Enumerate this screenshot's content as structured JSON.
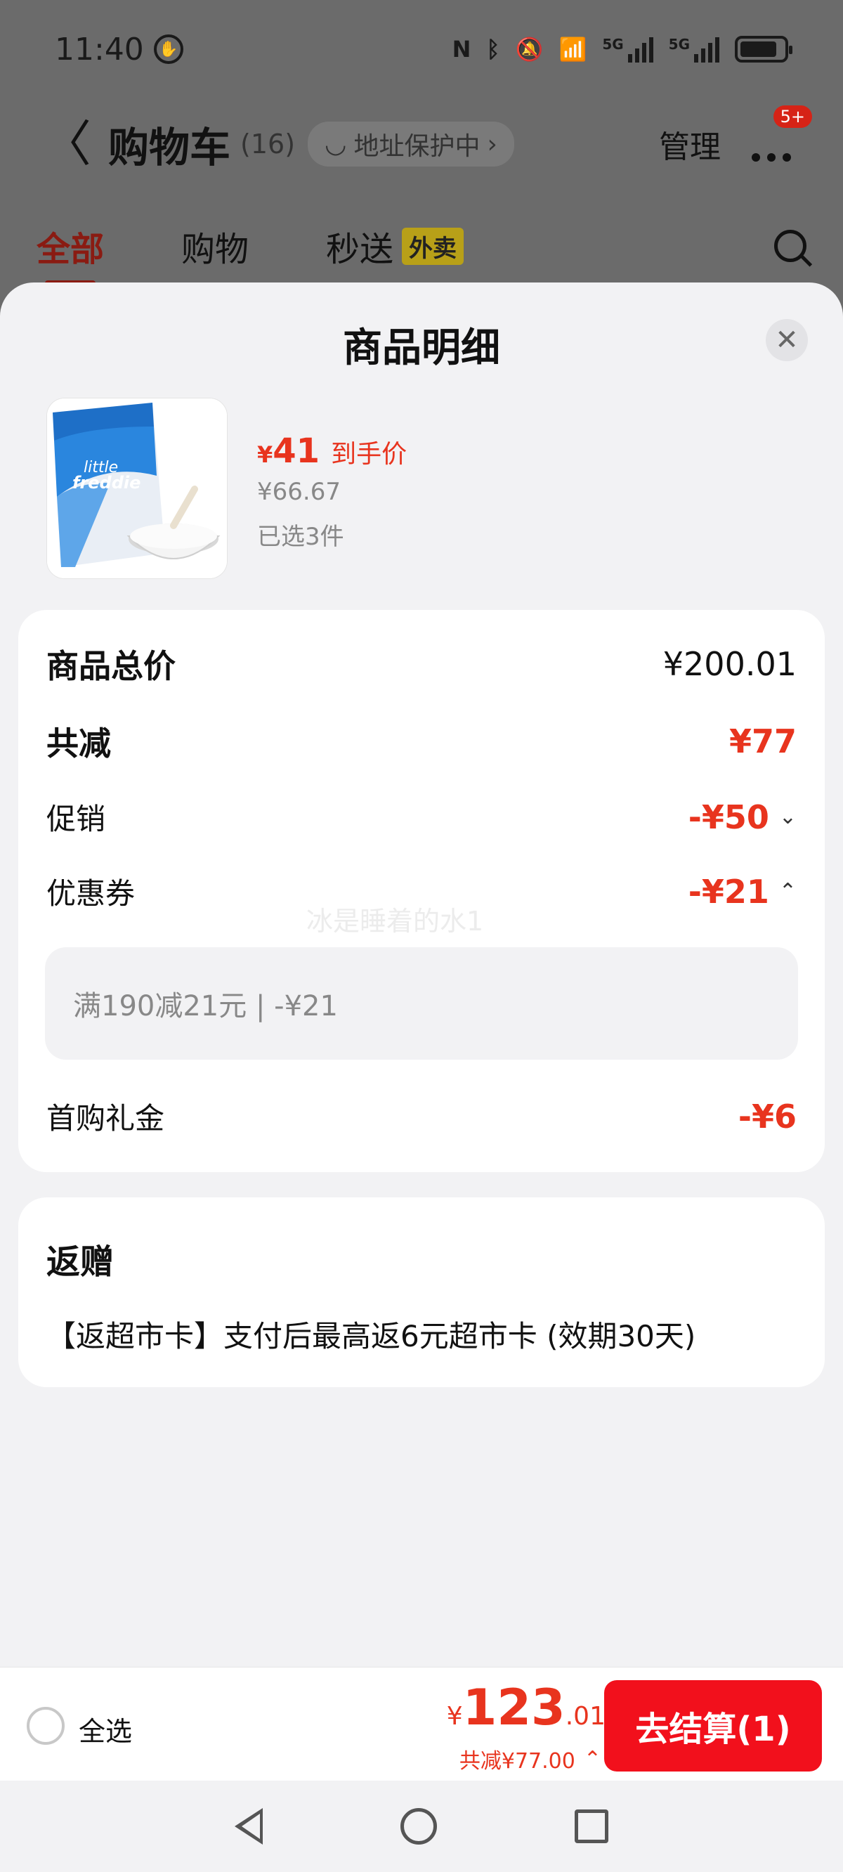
{
  "status": {
    "time": "11:40",
    "network_label_1": "5G",
    "network_label_2": "5G"
  },
  "header": {
    "back": "〈",
    "title": "购物车",
    "count": "(16)",
    "address_pill": "地址保护中",
    "address_chevron": "›",
    "manage": "管理",
    "badge": "5+"
  },
  "tabs": [
    {
      "label": "全部",
      "active": true
    },
    {
      "label": "购物"
    },
    {
      "label": "秒送",
      "tag": "外卖"
    }
  ],
  "sheet": {
    "title": "商品明细",
    "close": "✕",
    "product": {
      "price_symbol": "¥",
      "price": "41",
      "price_label": "到手价",
      "original_price": "¥66.67",
      "selected": "已选3件",
      "image_brand": "little freddie"
    },
    "summary": {
      "total_label": "商品总价",
      "total_value": "¥200.01",
      "discount_label": "共减",
      "discount_value": "¥77",
      "promo_label": "促销",
      "promo_value": "-¥50",
      "coupon_label": "优惠券",
      "coupon_value": "-¥21",
      "coupon_detail": "满190减21元 | -¥21",
      "first_gift_label": "首购礼金",
      "first_gift_value": "-¥6",
      "watermark": "冰是睡着的水1"
    },
    "gift": {
      "title": "返赠",
      "text": "【返超市卡】支付后最高返6元超市卡 (效期30天)"
    }
  },
  "bottom": {
    "select_all": "全选",
    "total_symbol": "¥",
    "total_int": "123",
    "total_dec": ".01",
    "total_discount": "共减¥77.00",
    "checkout": "去结算(1)"
  },
  "colors": {
    "accent": "#e8341e",
    "checkout": "#f2101c",
    "sheet_bg": "#f2f2f4"
  }
}
